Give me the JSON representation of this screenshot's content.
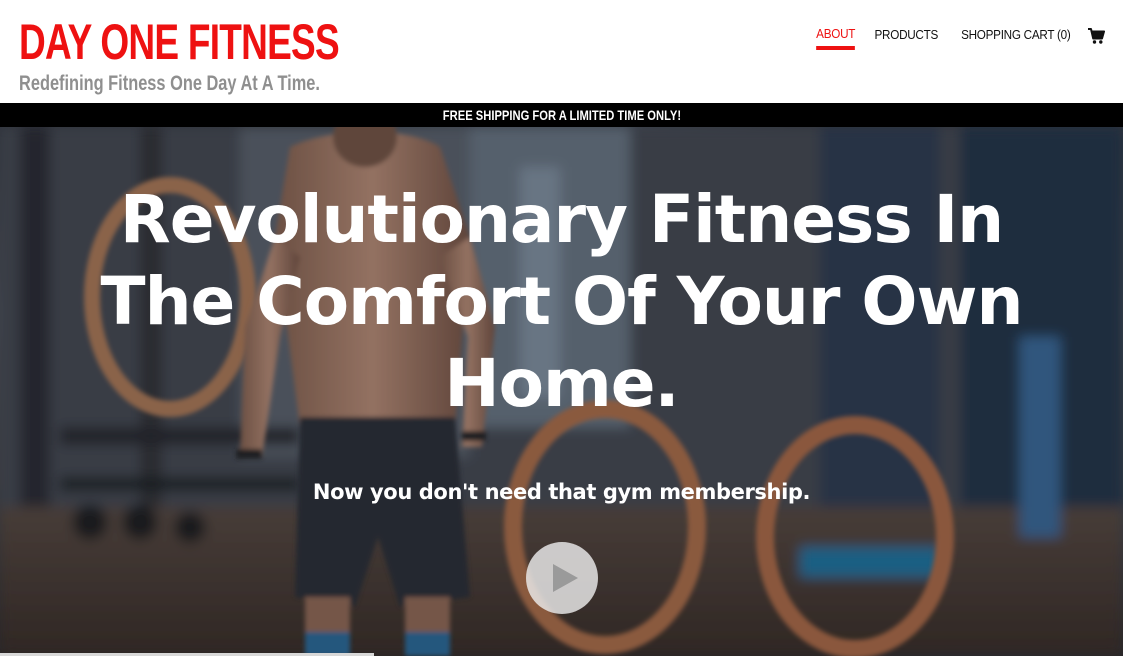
{
  "brand": {
    "title": "DAY ONE FITNESS",
    "tagline": "Redefining Fitness One Day At A Time."
  },
  "nav": {
    "items": [
      {
        "label": "ABOUT",
        "active": true
      },
      {
        "label": "PRODUCTS",
        "active": false
      },
      {
        "label": "SHOPPING CART (0)",
        "active": false
      }
    ],
    "cart_icon": "shopping-cart-icon"
  },
  "announcement": {
    "text": "FREE SHIPPING FOR A LIMITED TIME ONLY!"
  },
  "hero": {
    "headline": "Revolutionary Fitness In The Comfort Of Your Own Home.",
    "subheadline": "Now you don't need that gym membership.",
    "play_icon": "play-icon",
    "background": "gym-photo-man-with-rings"
  },
  "colors": {
    "brand_red": "#ee1111",
    "tagline_gray": "#8f8f8f",
    "bar_black": "#000000",
    "hero_text": "#ffffff"
  }
}
